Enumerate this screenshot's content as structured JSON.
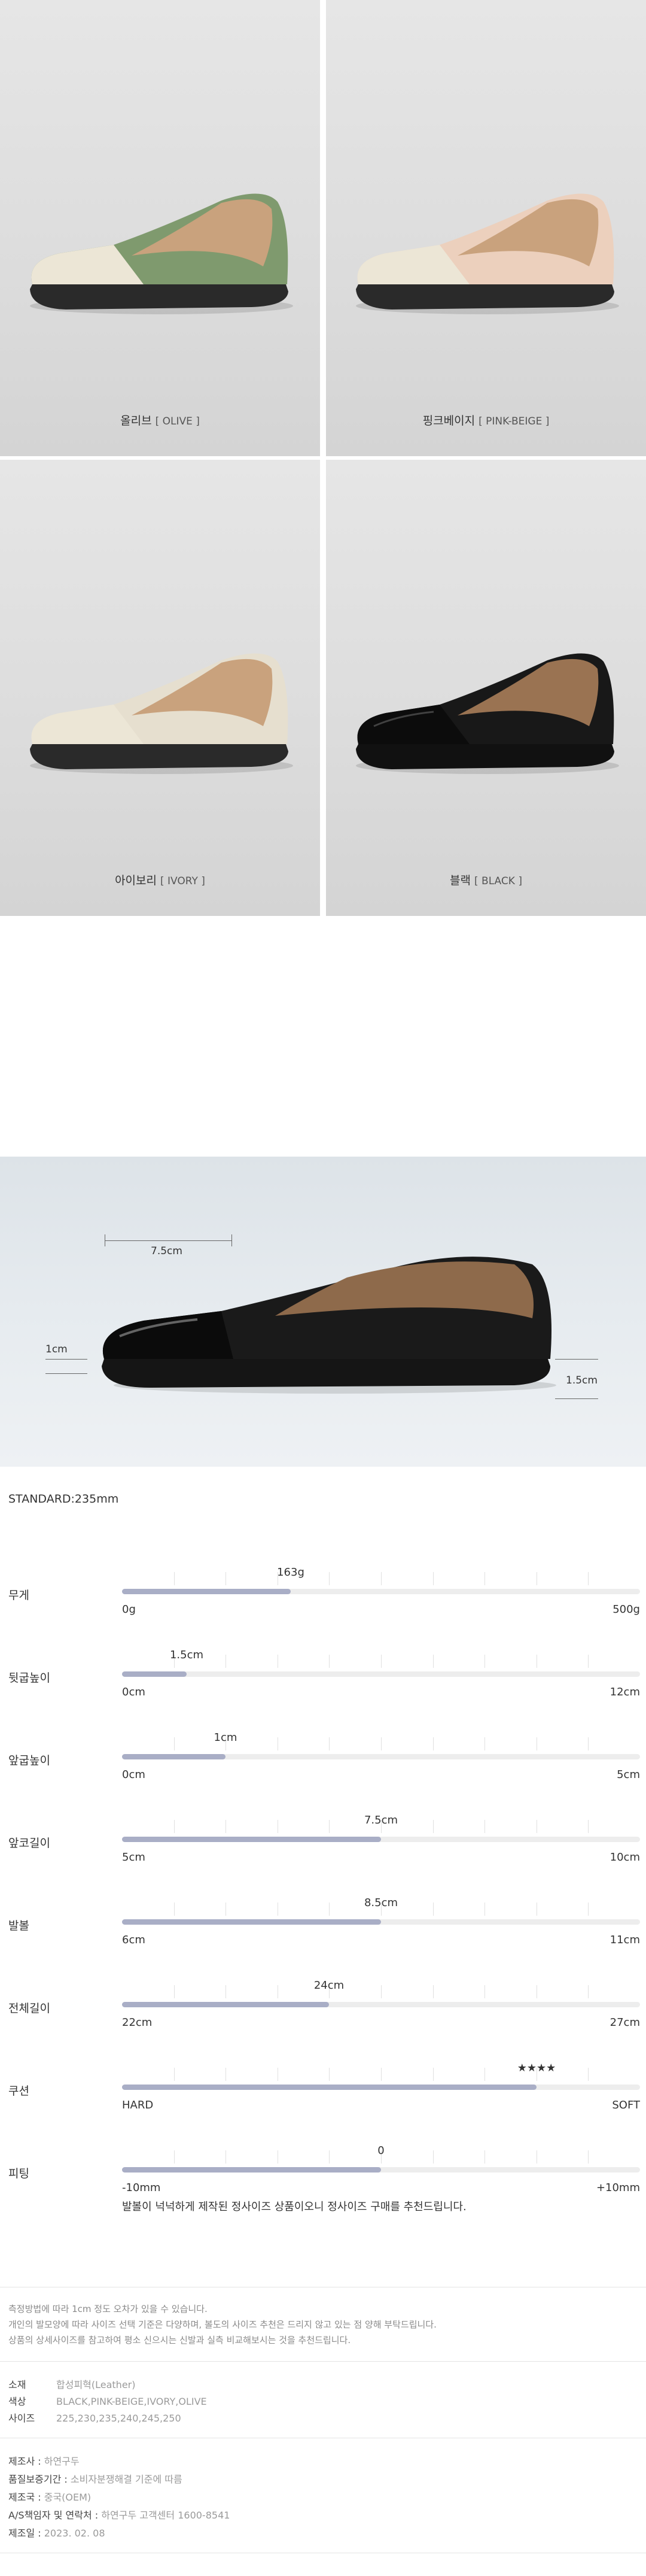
{
  "colors": [
    {
      "ko": "올리브",
      "en": "[ OLIVE ]",
      "upper": "#7f9a6e",
      "toe": "#ece6d6",
      "sole": "#2a2a2a"
    },
    {
      "ko": "핑크베이지",
      "en": "[ PINK-BEIGE ]",
      "upper": "#ecd0bd",
      "toe": "#ece6d6",
      "sole": "#2a2a2a"
    },
    {
      "ko": "아이보리",
      "en": "[ IVORY ]",
      "upper": "#e6dfcf",
      "toe": "#ece6d6",
      "sole": "#2a2a2a"
    },
    {
      "ko": "블랙",
      "en": "[ BLACK ]",
      "upper": "#181818",
      "toe": "#0c0c0c",
      "sole": "#111111"
    }
  ],
  "size_photo": {
    "toe_length": "7.5cm",
    "toe_height": "1cm",
    "heel_height": "1.5cm"
  },
  "standard": "STANDARD:235mm",
  "specs": [
    {
      "label": "무게",
      "value": "163g",
      "fill": 0.326,
      "min": "0g",
      "max": "500g"
    },
    {
      "label": "뒷굽높이",
      "value": "1.5cm",
      "fill": 0.125,
      "min": "0cm",
      "max": "12cm"
    },
    {
      "label": "앞굽높이",
      "value": "1cm",
      "fill": 0.2,
      "min": "0cm",
      "max": "5cm"
    },
    {
      "label": "앞코길이",
      "value": "7.5cm",
      "fill": 0.5,
      "min": "5cm",
      "max": "10cm"
    },
    {
      "label": "발볼",
      "value": "8.5cm",
      "fill": 0.5,
      "min": "6cm",
      "max": "11cm"
    },
    {
      "label": "전체길이",
      "value": "24cm",
      "fill": 0.4,
      "min": "22cm",
      "max": "27cm"
    },
    {
      "label": "쿠션",
      "value": "★★★★",
      "fill": 0.8,
      "min": "HARD",
      "max": "SOFT"
    },
    {
      "label": "피팅",
      "value": "0",
      "fill": 0.5,
      "min": "-10mm",
      "max": "+10mm"
    }
  ],
  "fit_note": "발볼이 넉넉하게 제작된 정사이즈 상품이오니 정사이즈 구매를 추천드립니다.",
  "disclaimer": [
    "측정방법에 따라 1cm 정도 오차가 있을 수 있습니다.",
    "개인의 발모양에 따라 사이즈 선택 기준은 다양하며, 볼도의 사이즈 추천은 드리지 않고 있는 점 양해 부탁드립니다.",
    "상품의 상세사이즈를 참고하여 평소 신으시는 신발과 실측 비교해보시는 것을 추천드립니다."
  ],
  "info": [
    {
      "k": "소재",
      "v": "합성피혁(Leather)"
    },
    {
      "k": "색상",
      "v": "BLACK,PINK-BEIGE,IVORY,OLIVE"
    },
    {
      "k": "사이즈",
      "v": "225,230,235,240,245,250"
    }
  ],
  "maker": [
    {
      "k": "제조사 : ",
      "v": "하연구두"
    },
    {
      "k": "품질보증기간 : ",
      "v": "소비자분쟁해결 기준에 따름"
    },
    {
      "k": "제조국 : ",
      "v": "중국(OEM)"
    },
    {
      "k": "A/S책임자 및 연락처 : ",
      "v": "하연구두 고객센터 1600-8541"
    },
    {
      "k": "제조일 : ",
      "v": "2023. 02. 08"
    }
  ]
}
